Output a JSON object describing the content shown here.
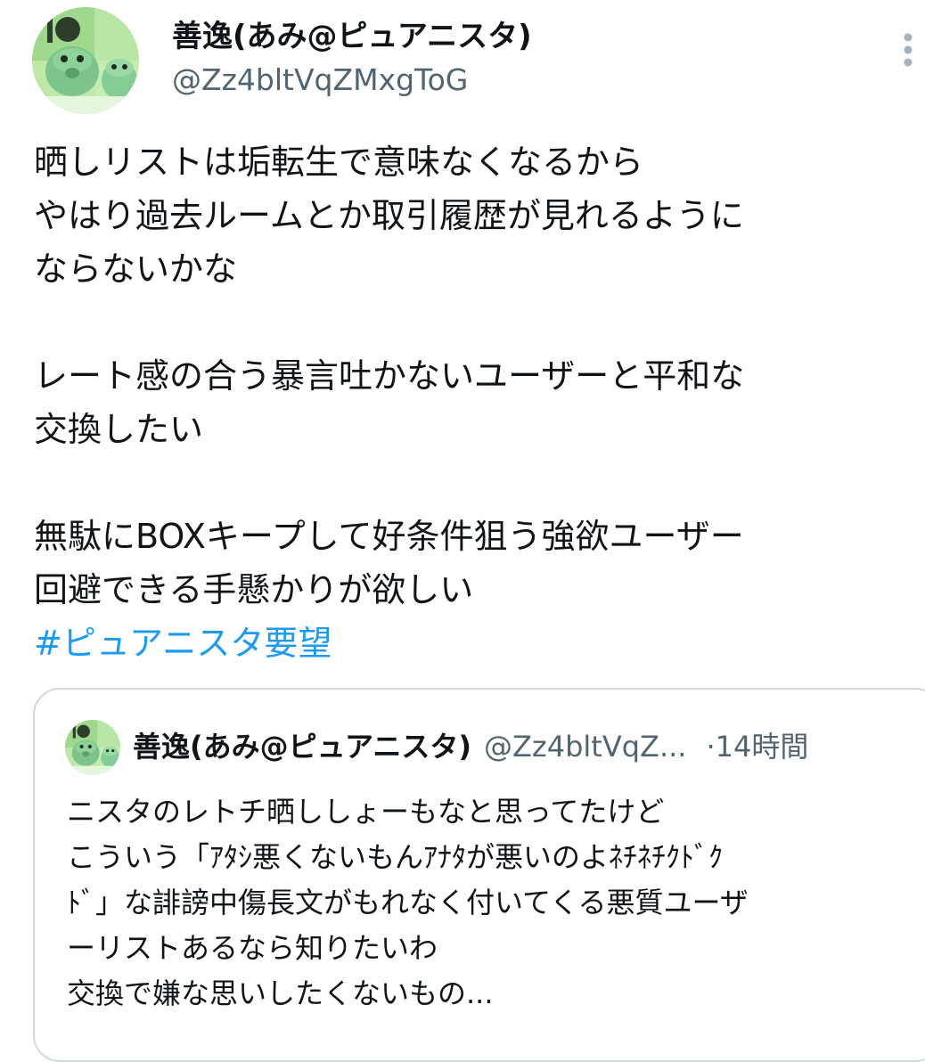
{
  "author": {
    "name": "善逸(あみ@ピュアニスタ)",
    "handle": "@Zz4bltVqZMxgToG",
    "avatar_icon": "avatar-illustration-icon"
  },
  "more_icon": "more-vertical-icon",
  "tweet": {
    "lines": [
      "晒しリストは垢転生で意味なくなるから",
      "やはり過去ルームとか取引履歴が見れるように",
      "ならないかな",
      "",
      "レート感の合う暴言吐かないユーザーと平和な",
      "交換したい",
      "",
      "無駄にBOXキープして好条件狙う強欲ユーザー",
      "回避できる手懸かりが欲しい"
    ],
    "hashtag": "#ピュアニスタ要望"
  },
  "quote": {
    "name": "善逸(あみ@ピュアニスタ)",
    "handle": "@Zz4bltVqZ...",
    "dot": "·",
    "time": "14時間",
    "lines": [
      "ニスタのレトチ晒ししょーもなと思ってたけど",
      "こういう「ｱﾀｼ悪くないもんｱﾅﾀが悪いのよﾈﾁﾈﾁｸﾄﾞｸ",
      "ﾄﾞ」な誹謗中傷長文がもれなく付いてくる悪質ユーザ",
      "ーリストあるなら知りたいわ",
      "交換で嫌な思いしたくないもの..."
    ]
  },
  "colors": {
    "text_primary": "#0f1419",
    "text_secondary": "#536471",
    "link": "#1d9bf0",
    "border": "#cfd9de",
    "avatar_bg": "#8fd08c"
  }
}
